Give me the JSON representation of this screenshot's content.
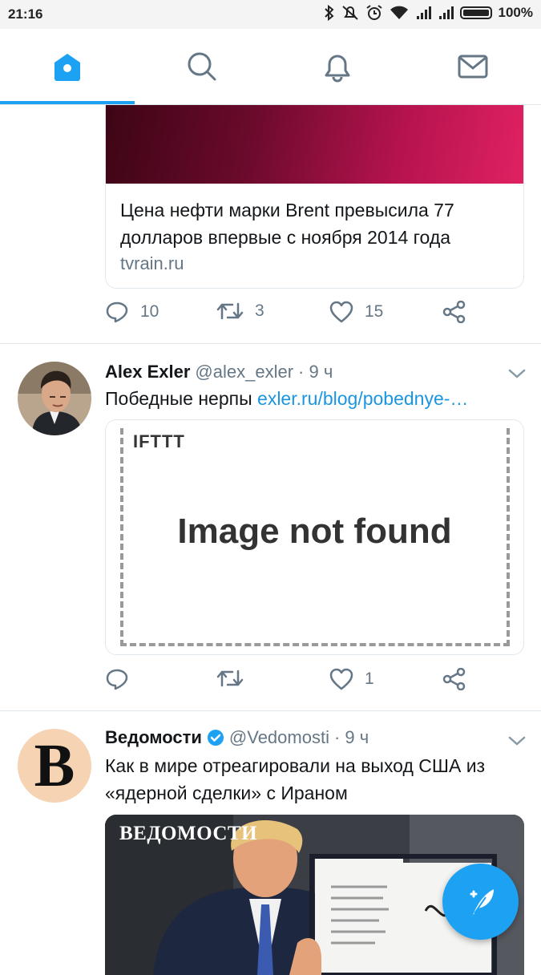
{
  "status_bar": {
    "time": "21:16",
    "battery": "100%"
  },
  "tabs": [
    {
      "name": "home",
      "icon": "home-icon",
      "active": true
    },
    {
      "name": "search",
      "icon": "search-icon",
      "active": false
    },
    {
      "name": "notifications",
      "icon": "bell-icon",
      "active": false
    },
    {
      "name": "messages",
      "icon": "envelope-icon",
      "active": false
    }
  ],
  "colors": {
    "accent": "#1da1f2",
    "link": "#1b95e0",
    "muted": "#657786",
    "text": "#14171a"
  },
  "feed": {
    "tweet0": {
      "card_title": "Цена нефти марки Brent превысила 77 долларов впервые с ноября 2014 года",
      "card_domain": "tvrain.ru",
      "replies": "10",
      "retweets": "3",
      "likes": "15"
    },
    "tweet1": {
      "name": "Alex Exler",
      "handle": "@alex_exler",
      "time": "· 9 ч",
      "text": "Победные нерпы ",
      "link": "exler.ru/blog/pobednye-…",
      "card_label": "IFTTT",
      "card_message": "Image not found",
      "replies": "",
      "retweets": "",
      "likes": "1"
    },
    "tweet2": {
      "name": "Ведомости",
      "handle": "@Vedomosti",
      "time": "· 9 ч",
      "text": "Как в мире отреагировали на выход США из «ядерной сделки» с Ираном",
      "photo_watermark": "ВЕДОМОСТИ",
      "avatar_letter": "B"
    }
  }
}
